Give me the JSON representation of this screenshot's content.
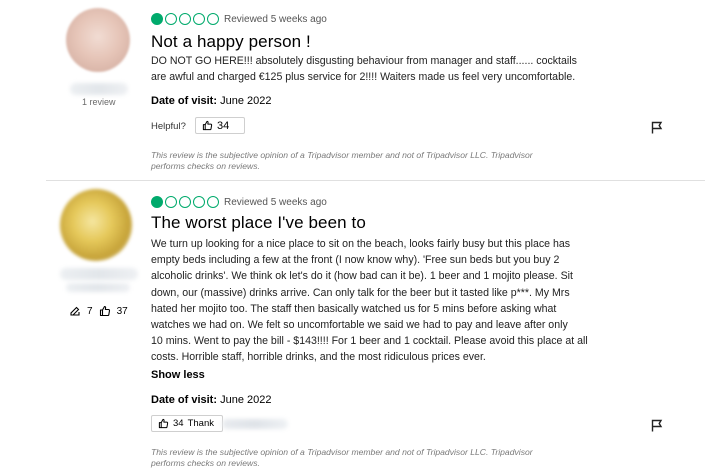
{
  "reviews": [
    {
      "contributions": "1 review",
      "rating": 1,
      "meta": "Reviewed 5 weeks ago",
      "title": "Not a happy person !",
      "body": [
        "DO NOT GO HERE!!! absolutely disgusting behaviour from manager and staff...... cocktails",
        "are awful and charged €125 plus service for 2!!!! Waiters made us feel very uncomfortable."
      ],
      "date_label": "Date of visit:",
      "date_value": "June 2022",
      "helpful_label": "Helpful?",
      "helpful_count": "34",
      "disclaimer": [
        "This review is the subjective opinion of a Tripadvisor member and not of Tripadvisor LLC. Tripadvisor",
        "performs checks on reviews."
      ]
    },
    {
      "contrib_count": "7",
      "helpful_votes": "37",
      "rating": 1,
      "meta": "Reviewed 5 weeks ago",
      "title": "The worst place I've been to",
      "body": [
        "We turn up looking for a nice place to sit on the beach, looks fairly busy but this place has",
        "empty beds including a few at the front (I now know why). 'Free sun beds but you buy 2",
        "alcoholic drinks'. We think ok let's do it (how bad can it be). 1 beer and 1 mojito please. Sit",
        "down, our (massive) drinks arrive. Can only talk for the beer but it tasted like p***. My Mrs",
        "hated her mojito too. The staff then basically watched us for 5 mins before asking what",
        "watches we had on. We felt so uncomfortable we said we had to pay and leave after only",
        "10 mins. Went to pay the bill - $143!!!! For 1 beer and 1 cocktail. Please avoid this place at all",
        "costs. Horrible staff, horrible drinks, and the most ridiculous prices ever."
      ],
      "show_less": "Show less",
      "date_label": "Date of visit:",
      "date_value": "June 2022",
      "thank_count": "34",
      "thank_label": "Thank",
      "disclaimer": [
        "This review is the subjective opinion of a Tripadvisor member and not of Tripadvisor LLC. Tripadvisor",
        "performs checks on reviews."
      ]
    }
  ],
  "colors": {
    "bubble": "#00aa6c",
    "divider": "#e0e0e0"
  },
  "icons": [
    "thumbs-up-icon",
    "flag-icon",
    "edit-icon"
  ]
}
